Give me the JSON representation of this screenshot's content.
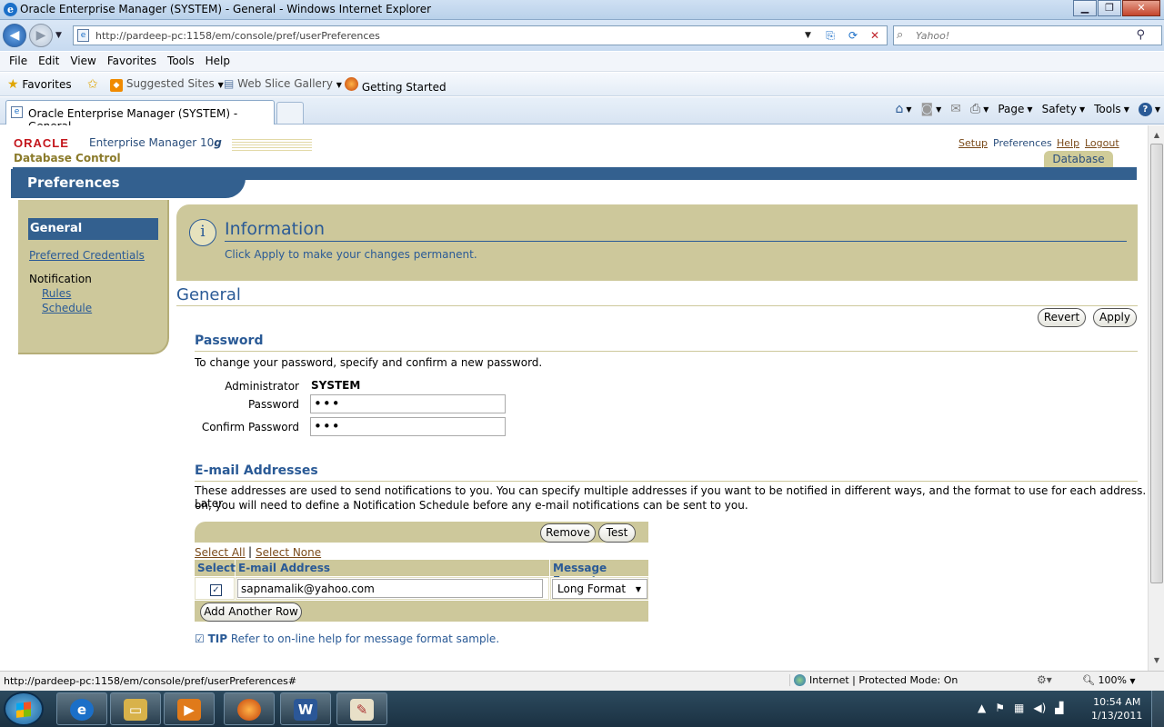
{
  "window": {
    "title": "Oracle Enterprise Manager (SYSTEM) - General - Windows Internet Explorer"
  },
  "address": {
    "url": "http://pardeep-pc:1158/em/console/pref/userPreferences",
    "search_placeholder": "Yahoo!"
  },
  "menu": [
    "File",
    "Edit",
    "View",
    "Favorites",
    "Tools",
    "Help"
  ],
  "favorites": {
    "favorites_label": "Favorites",
    "suggested_sites": "Suggested Sites",
    "web_slice_gallery": "Web Slice Gallery",
    "getting_started": "Getting Started"
  },
  "tab": {
    "label": "Oracle Enterprise Manager (SYSTEM) - General"
  },
  "command_bar": {
    "page": "Page",
    "safety": "Safety",
    "tools": "Tools"
  },
  "em_header": {
    "oracle": "ORACLE",
    "product": "Enterprise Manager 10",
    "version_suffix": "g",
    "subtitle": "Database Control",
    "links": {
      "setup": "Setup",
      "preferences": "Preferences",
      "help": "Help",
      "logout": "Logout"
    },
    "database_tab": "Database",
    "page_header": "Preferences"
  },
  "sidenav": {
    "general": "General",
    "preferred_credentials": "Preferred Credentials",
    "notification": "Notification",
    "rules": "Rules",
    "schedule": "Schedule"
  },
  "info": {
    "title": "Information",
    "message": "Click Apply to make your changes permanent."
  },
  "general": {
    "heading": "General",
    "revert": "Revert",
    "apply": "Apply"
  },
  "password": {
    "heading": "Password",
    "instructions": "To change your password, specify and confirm a new password.",
    "admin_label": "Administrator",
    "admin_value": "SYSTEM",
    "password_label": "Password",
    "password_value": "•••",
    "confirm_label": "Confirm Password",
    "confirm_value": "•••"
  },
  "email": {
    "heading": "E-mail Addresses",
    "description_line1": "These addresses are used to send notifications to you. You can specify multiple addresses if you want to be notified in different ways, and the format to use for each address. Later",
    "description_line2": "on, you will need to define a Notification Schedule before any e-mail notifications can be sent to you.",
    "remove": "Remove",
    "test": "Test",
    "select_all": "Select All",
    "separator": "|",
    "select_none": "Select None",
    "columns": [
      "Select",
      "E-mail Address",
      "Message Format"
    ],
    "rows": [
      {
        "checked": true,
        "check_glyph": "✓",
        "address": "sapnamalik@yahoo.com",
        "format": "Long Format"
      }
    ],
    "add_row": "Add Another Row",
    "tip_label": "TIP",
    "tip_text": "Refer to on-line help for message format sample."
  },
  "status": {
    "url": "http://pardeep-pc:1158/em/console/pref/userPreferences#",
    "zone": "Internet | Protected Mode: On",
    "zoom": "100%"
  },
  "clock": {
    "time": "10:54 AM",
    "date": "1/13/2011"
  }
}
